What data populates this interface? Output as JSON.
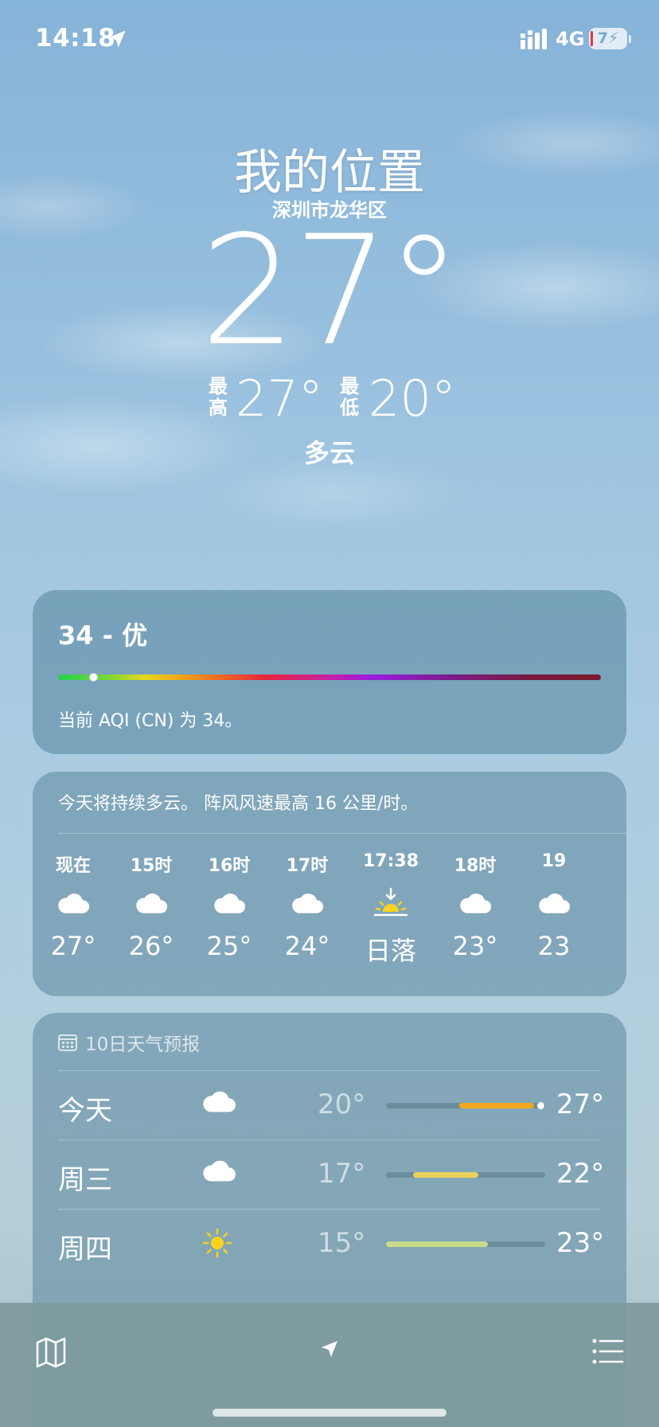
{
  "status_bar": {
    "time": "14:18",
    "network": "4G",
    "battery": "7"
  },
  "header": {
    "title": "我的位置",
    "district": "深圳市龙华区",
    "temperature": "27°",
    "high_label": "最高",
    "high": "27°",
    "low_label": "最低",
    "low": "20°",
    "condition": "多云"
  },
  "aqi": {
    "value_text": "34 - 优",
    "description": "当前 AQI (CN) 为 34。",
    "value": 34,
    "scale_position": 0.065
  },
  "hourly": {
    "summary": "今天将持续多云。 阵风风速最高 16 公里/时。",
    "items": [
      {
        "label": "现在",
        "icon": "cloud-icon",
        "temp": "27°"
      },
      {
        "label": "15时",
        "icon": "cloud-icon",
        "temp": "26°"
      },
      {
        "label": "16时",
        "icon": "cloud-icon",
        "temp": "25°"
      },
      {
        "label": "17时",
        "icon": "cloud-icon",
        "temp": "24°"
      },
      {
        "label": "17:38",
        "icon": "sunset-icon",
        "temp": "日落"
      },
      {
        "label": "18时",
        "icon": "cloud-icon",
        "temp": "23°"
      },
      {
        "label": "19",
        "icon": "cloud-icon",
        "temp": "23"
      }
    ]
  },
  "daily": {
    "header": "10日天气预报",
    "days": [
      {
        "name": "今天",
        "icon": "cloud-icon",
        "low": "20°",
        "high": "27°",
        "range_start": 0.46,
        "range_end": 0.93,
        "color": "#f2a81d",
        "current": 0.97
      },
      {
        "name": "周三",
        "icon": "cloud-icon",
        "low": "17°",
        "high": "22°",
        "range_start": 0.17,
        "range_end": 0.58,
        "color": "#e8d25a",
        "current": null
      },
      {
        "name": "周四",
        "icon": "sun-icon",
        "low": "15°",
        "high": "23°",
        "range_start": 0.0,
        "range_end": 0.64,
        "color": "#c8dc8c",
        "current": null
      }
    ]
  },
  "colors": {
    "sun": "#f7d21e"
  }
}
